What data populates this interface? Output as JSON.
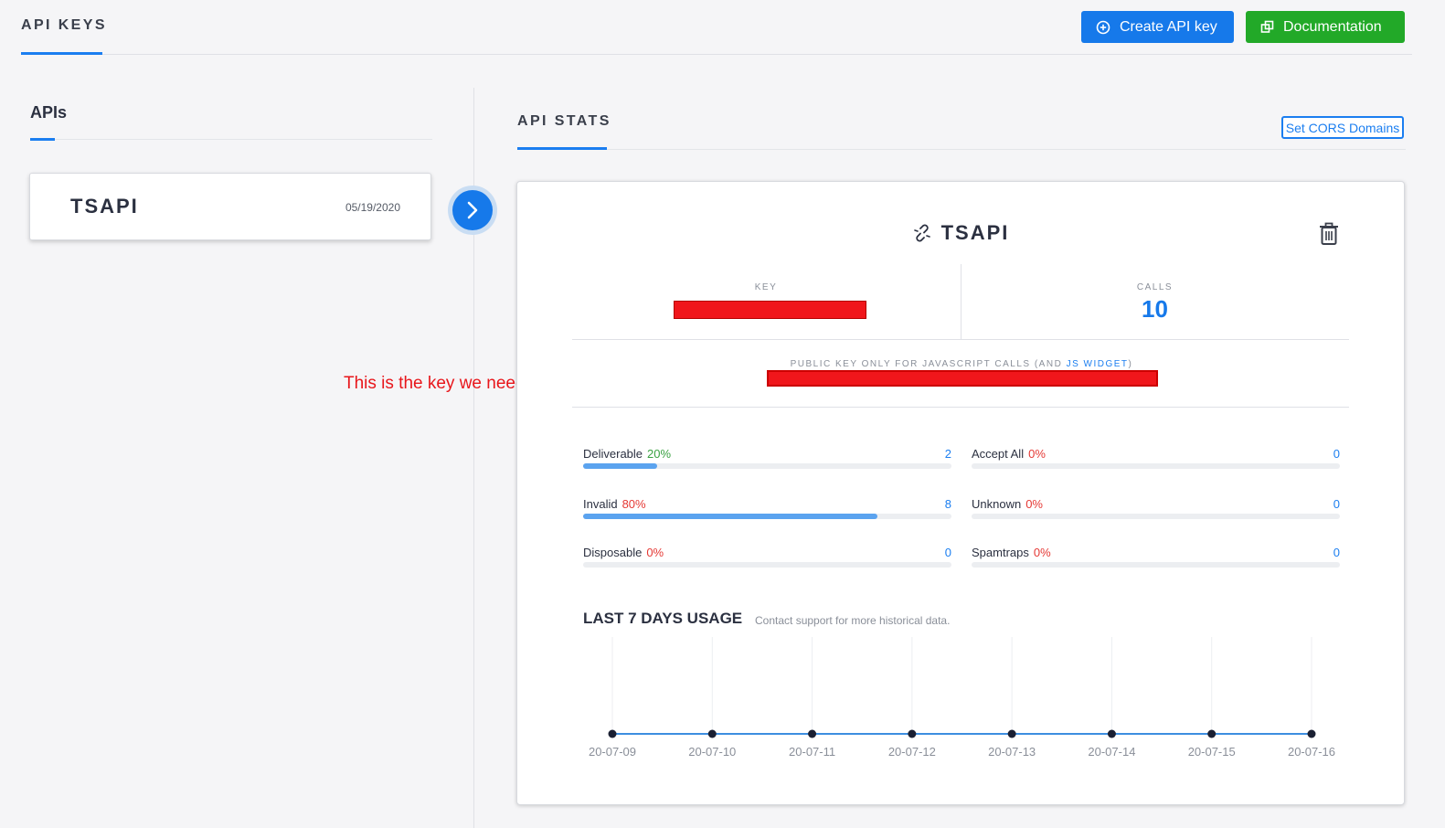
{
  "header": {
    "tab_label": "API KEYS",
    "create_button_label": "Create API key",
    "docs_button_label": "Documentation",
    "create_color": "#1679ea",
    "docs_color": "#22a928"
  },
  "sidebar": {
    "title": "APIs",
    "items": [
      {
        "name": "TSAPI",
        "date": "05/19/2020"
      }
    ]
  },
  "annotation": {
    "text": "This is the key we need"
  },
  "stats": {
    "title": "API STATS",
    "cors_button_label": "Set CORS Domains",
    "api_name": "TSAPI",
    "key_label": "KEY",
    "calls_label": "CALLS",
    "calls_value": "10",
    "public_key_label": "PUBLIC KEY ONLY FOR JAVASCRIPT CALLS (AND ",
    "public_key_link": "JS WIDGET",
    "public_key_label_end": ")",
    "metrics": [
      {
        "label": "Deliverable",
        "pct": "20%",
        "count": "2",
        "fraction": 0.2,
        "pct_color": "green"
      },
      {
        "label": "Accept All",
        "pct": "0%",
        "count": "0",
        "fraction": 0,
        "pct_color": "red"
      },
      {
        "label": "Invalid",
        "pct": "80%",
        "count": "8",
        "fraction": 0.8,
        "pct_color": "red"
      },
      {
        "label": "Unknown",
        "pct": "0%",
        "count": "0",
        "fraction": 0,
        "pct_color": "red"
      },
      {
        "label": "Disposable",
        "pct": "0%",
        "count": "0",
        "fraction": 0,
        "pct_color": "red"
      },
      {
        "label": "Spamtraps",
        "pct": "0%",
        "count": "0",
        "fraction": 0,
        "pct_color": "red"
      }
    ],
    "usage_title": "LAST 7 DAYS USAGE",
    "usage_subtitle": "Contact support for more historical data."
  },
  "chart_data": {
    "type": "line",
    "x": [
      "20-07-09",
      "20-07-10",
      "20-07-11",
      "20-07-12",
      "20-07-13",
      "20-07-14",
      "20-07-15",
      "20-07-16"
    ],
    "series": [
      {
        "values": [
          0,
          0,
          0,
          0,
          0,
          0,
          0,
          0
        ]
      }
    ],
    "title": "LAST 7 DAYS USAGE",
    "ylim": [
      0,
      10
    ],
    "grid": "vertical",
    "line_color": "#3d8ee0",
    "point_color": "#1b2033"
  }
}
